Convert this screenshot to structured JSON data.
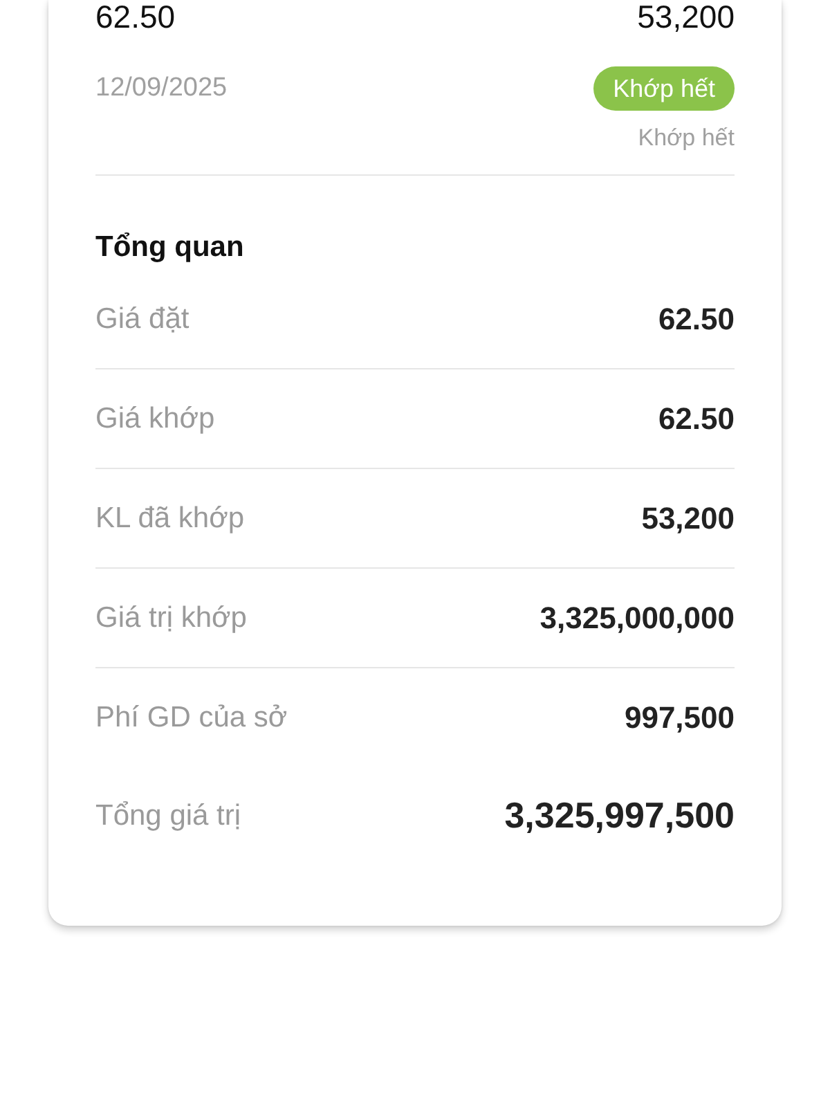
{
  "order": {
    "price": "62.50",
    "quantity": "53,200",
    "date": "12/09/2025",
    "status_badge": "Khớp hết",
    "status_text": "Khớp hết"
  },
  "overview": {
    "title": "Tổng quan",
    "rows": [
      {
        "kind": "normal",
        "label": "Giá đặt",
        "value": "62.50"
      },
      {
        "kind": "normal",
        "label": "Giá khớp",
        "value": "62.50"
      },
      {
        "kind": "normal",
        "label": "KL đã khớp",
        "value": "53,200"
      },
      {
        "kind": "normal",
        "label": "Giá trị khớp",
        "value": "3,325,000,000"
      },
      {
        "kind": "normal",
        "label": "Phí GD của sở",
        "value": "997,500"
      },
      {
        "kind": "total",
        "label": "Tổng giá trị",
        "value": "3,325,997,500"
      }
    ]
  }
}
